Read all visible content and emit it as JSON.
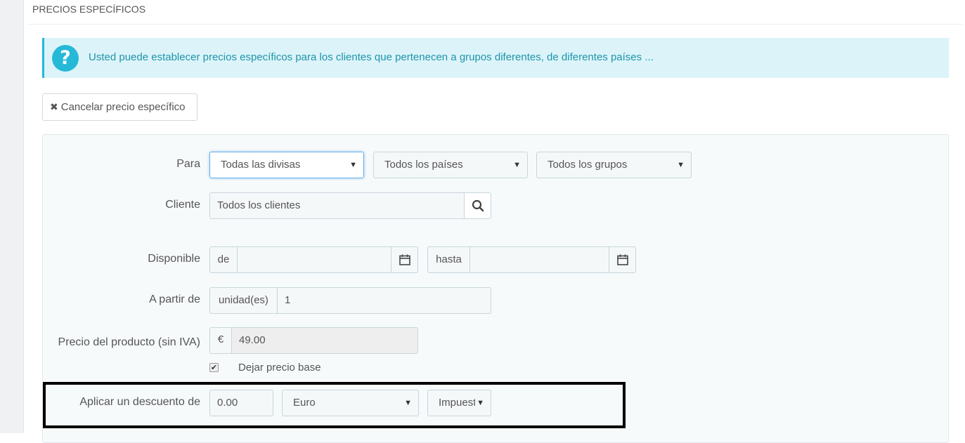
{
  "panel": {
    "heading": "PRECIOS ESPECÍFICOS"
  },
  "alert": {
    "icon": "question-icon",
    "icon_glyph": "?",
    "text": "Usted puede establecer precios específicos para los clientes que pertenecen a grupos diferentes, de diferentes países ..."
  },
  "cancel_button": {
    "icon": "times-icon",
    "icon_glyph": "✖",
    "label": "Cancelar precio específico"
  },
  "form": {
    "para": {
      "label": "Para",
      "currency": "Todas las divisas",
      "country": "Todos los países",
      "group": "Todos los grupos"
    },
    "cliente": {
      "label": "Cliente",
      "value": "Todos los clientes",
      "search_icon": "search-icon"
    },
    "disponible": {
      "label": "Disponible",
      "from_label": "de",
      "from_value": "",
      "to_label": "hasta",
      "to_value": "",
      "calendar_icon": "calendar-icon"
    },
    "a_partir_de": {
      "label": "A partir de",
      "unit_label": "unidad(es)",
      "value": "1"
    },
    "precio": {
      "label": "Precio del producto (sin IVA)",
      "currency_symbol": "€",
      "value": "49.00",
      "leave_base_label": "Dejar precio base",
      "leave_base_checked": true,
      "check_glyph": "✔"
    },
    "descuento": {
      "label": "Aplicar un descuento de",
      "value": "0.00",
      "type": "Euro",
      "tax": "Impuestos incluidos"
    },
    "dropdown_glyph": "▼"
  },
  "colors": {
    "accent": "#25b9d7",
    "alert_bg": "#dcf4f9",
    "alert_text": "#1e94ab",
    "highlight_border": "#000000"
  }
}
